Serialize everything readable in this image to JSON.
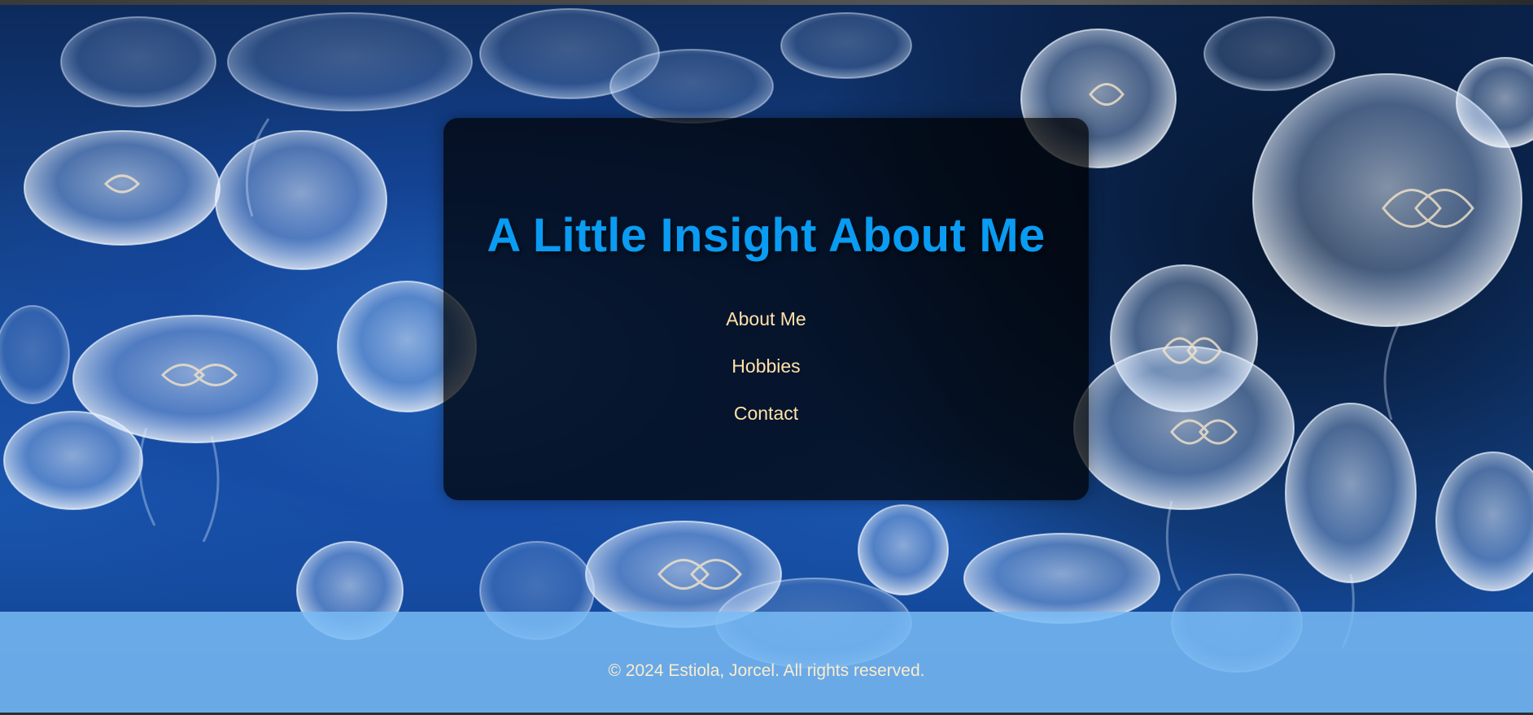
{
  "header": {
    "title": "A Little Insight About Me"
  },
  "nav": {
    "items": [
      {
        "label": "About Me"
      },
      {
        "label": "Hobbies"
      },
      {
        "label": "Contact"
      }
    ]
  },
  "footer": {
    "text": "© 2024 Estiola, Jorcel. All rights reserved."
  },
  "background": {
    "image": "jellyfish-photo"
  },
  "colors": {
    "title": "#0a9bf2",
    "nav_link": "#ffe2a8",
    "footer_bg": "#78baf5",
    "footer_text": "#fbeccc",
    "card_bg": "#000000"
  }
}
